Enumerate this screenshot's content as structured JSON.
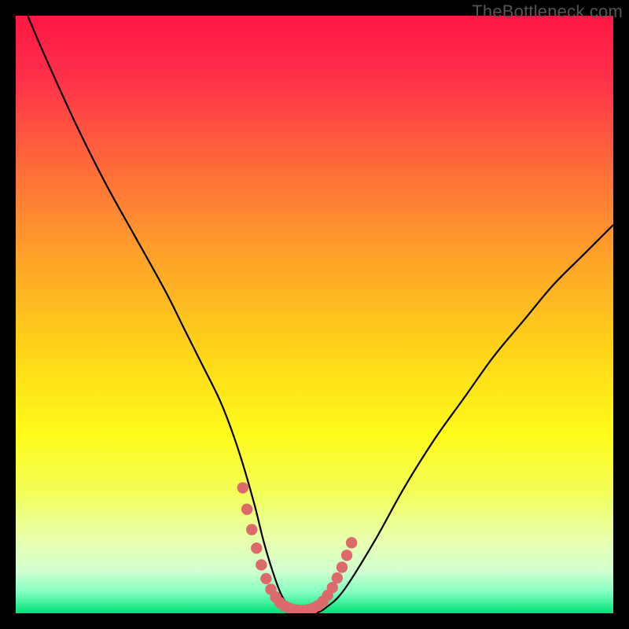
{
  "watermark": "TheBottleneck.com",
  "colors": {
    "frame": "#000000",
    "curve": "#000000",
    "accent": "#dd6a6a",
    "gradient_stops": [
      {
        "offset": 0.0,
        "color": "#ff1744"
      },
      {
        "offset": 0.1,
        "color": "#ff2f4a"
      },
      {
        "offset": 0.25,
        "color": "#ff6a3a"
      },
      {
        "offset": 0.4,
        "color": "#ffa12a"
      },
      {
        "offset": 0.55,
        "color": "#ffd11a"
      },
      {
        "offset": 0.7,
        "color": "#fffb1a"
      },
      {
        "offset": 0.8,
        "color": "#f3ff5a"
      },
      {
        "offset": 0.88,
        "color": "#e7ffb0"
      },
      {
        "offset": 0.93,
        "color": "#d0ffd0"
      },
      {
        "offset": 0.965,
        "color": "#80ffc0"
      },
      {
        "offset": 1.0,
        "color": "#00e078"
      }
    ]
  },
  "chart_data": {
    "type": "line",
    "title": "",
    "xlabel": "",
    "ylabel": "",
    "xlim": [
      0,
      100
    ],
    "ylim": [
      0,
      100
    ],
    "grid": false,
    "legend": false,
    "series": [
      {
        "name": "bottleneck-curve",
        "x": [
          2,
          5,
          10,
          15,
          20,
          25,
          28,
          31,
          34,
          36,
          38,
          40,
          41.5,
          43,
          44.5,
          46,
          48,
          50,
          52,
          55,
          60,
          65,
          70,
          75,
          80,
          85,
          90,
          95,
          100
        ],
        "values": [
          100,
          93,
          82,
          72,
          63,
          54,
          48,
          42,
          36,
          31,
          25,
          18,
          12,
          7,
          3,
          1,
          0,
          0,
          1,
          4,
          12,
          21,
          29,
          36,
          43,
          49,
          55,
          60,
          65
        ]
      },
      {
        "name": "sweet-spot-marker",
        "x": [
          38.0,
          38.7,
          39.5,
          40.3,
          41.1,
          41.9,
          42.7,
          43.5,
          44.2,
          45.0,
          45.8,
          46.6,
          47.4,
          48.2,
          49.0,
          49.8,
          50.6,
          51.4,
          52.2,
          53.0,
          53.8,
          54.6,
          55.4,
          56.2
        ],
        "values": [
          21.0,
          17.4,
          14.0,
          10.9,
          8.1,
          5.8,
          4.0,
          2.7,
          1.8,
          1.2,
          0.85,
          0.6,
          0.5,
          0.5,
          0.6,
          0.85,
          1.3,
          2.0,
          3.0,
          4.3,
          5.9,
          7.7,
          9.7,
          11.8
        ]
      }
    ]
  }
}
